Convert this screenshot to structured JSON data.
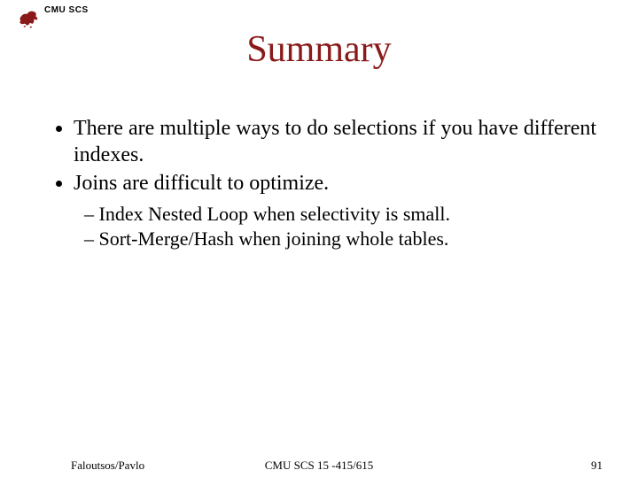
{
  "header": {
    "org": "CMU SCS"
  },
  "title": "Summary",
  "bullets": [
    "There are multiple ways to do selections if you have different indexes.",
    "Joins are difficult to optimize."
  ],
  "subbullets": [
    "Index Nested Loop when selectivity is small.",
    "Sort-Merge/Hash when joining whole tables."
  ],
  "footer": {
    "left": "Faloutsos/Pavlo",
    "center": "CMU SCS 15 -415/615",
    "right": "91"
  },
  "colors": {
    "title": "#8a1a1a",
    "logo": "#8a1a1a"
  }
}
